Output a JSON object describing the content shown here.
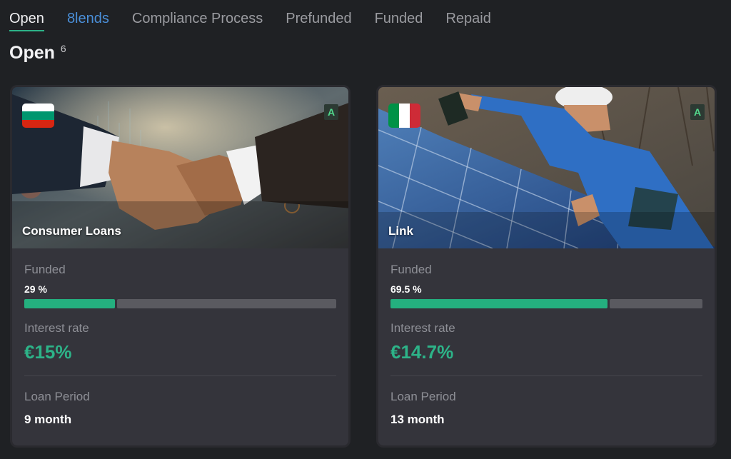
{
  "tabs": [
    {
      "label": "Open",
      "active": true
    },
    {
      "label": "8lends",
      "active": false
    },
    {
      "label": "Compliance Process",
      "active": false
    },
    {
      "label": "Prefunded",
      "active": false
    },
    {
      "label": "Funded",
      "active": false
    },
    {
      "label": "Repaid",
      "active": false
    }
  ],
  "heading": {
    "title": "Open",
    "count": "6"
  },
  "cards": [
    {
      "title": "Consumer Loans",
      "flag": "bulgaria-flag",
      "grade": "A",
      "funded_label": "Funded",
      "funded_pct": "29 %",
      "funded_fraction": 0.29,
      "rate_label": "Interest rate",
      "rate": "€15%",
      "period_label": "Loan Period",
      "period": "9 month"
    },
    {
      "title": "Link",
      "flag": "italy-flag",
      "grade": "A",
      "funded_label": "Funded",
      "funded_pct": "69.5 %",
      "funded_fraction": 0.695,
      "rate_label": "Interest rate",
      "rate": "€14.7%",
      "period_label": "Loan Period",
      "period": "13 month"
    }
  ],
  "colors": {
    "accent": "#2db388",
    "background": "#1f2124",
    "card": "#34343b",
    "brand_tab": "#4a8fd9"
  }
}
